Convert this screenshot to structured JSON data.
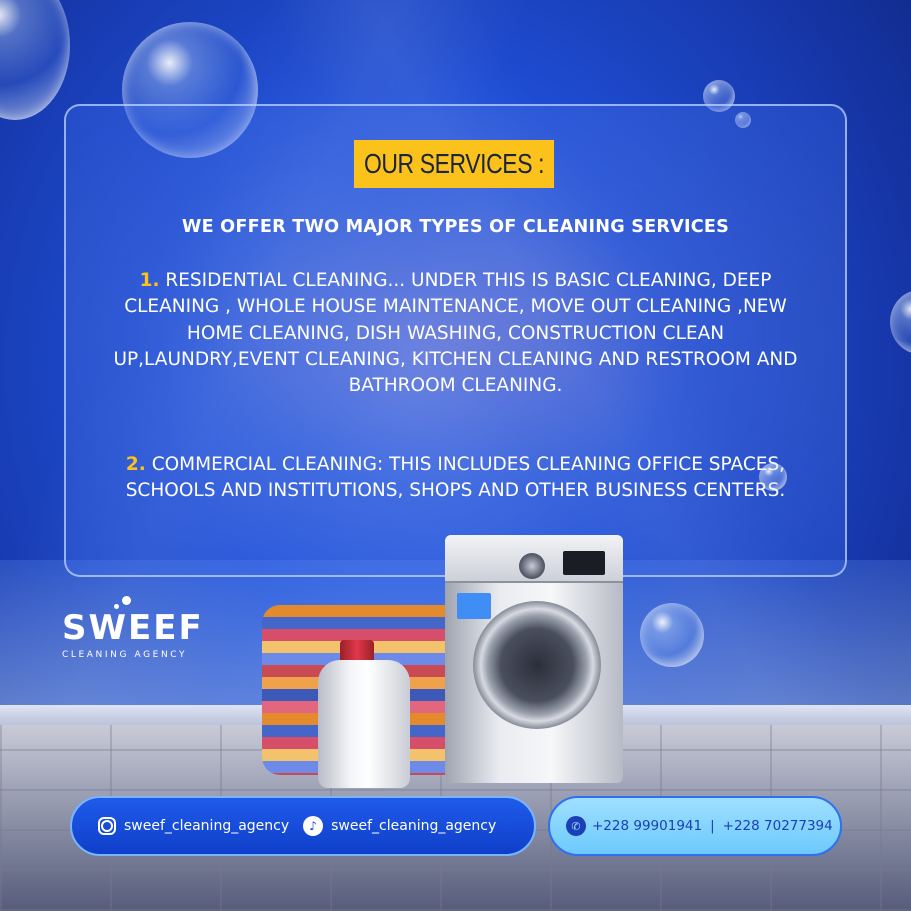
{
  "panel": {
    "title": "OUR SERVICES :",
    "headline": "WE OFFER TWO MAJOR TYPES OF CLEANING SERVICES",
    "services": [
      {
        "number": "1.",
        "text": "RESIDENTIAL CLEANING... UNDER THIS IS BASIC CLEANING, DEEP CLEANING , WHOLE HOUSE MAINTENANCE, MOVE OUT CLEANING ,NEW HOME CLEANING, DISH WASHING, CONSTRUCTION CLEAN UP,LAUNDRY,EVENT CLEANING, KITCHEN CLEANING AND RESTROOM AND BATHROOM CLEANING."
      },
      {
        "number": "2.",
        "text": "COMMERCIAL CLEANING: THIS INCLUDES CLEANING OFFICE SPACES, SCHOOLS AND INSTITUTIONS, SHOPS AND OTHER BUSINESS CENTERS."
      }
    ]
  },
  "brand": {
    "name": "SWEEF",
    "tagline": "CLEANING AGENCY"
  },
  "contact": {
    "instagram": "sweef_cleaning_agency",
    "tiktok": "sweef_cleaning_agency",
    "phone1": "+228 99901941",
    "separator": "|",
    "phone2": "+228 70277394"
  },
  "colors": {
    "accent": "#fbc21b",
    "background": "#1f4fd6",
    "phone_pill": "#9fe0ff"
  }
}
